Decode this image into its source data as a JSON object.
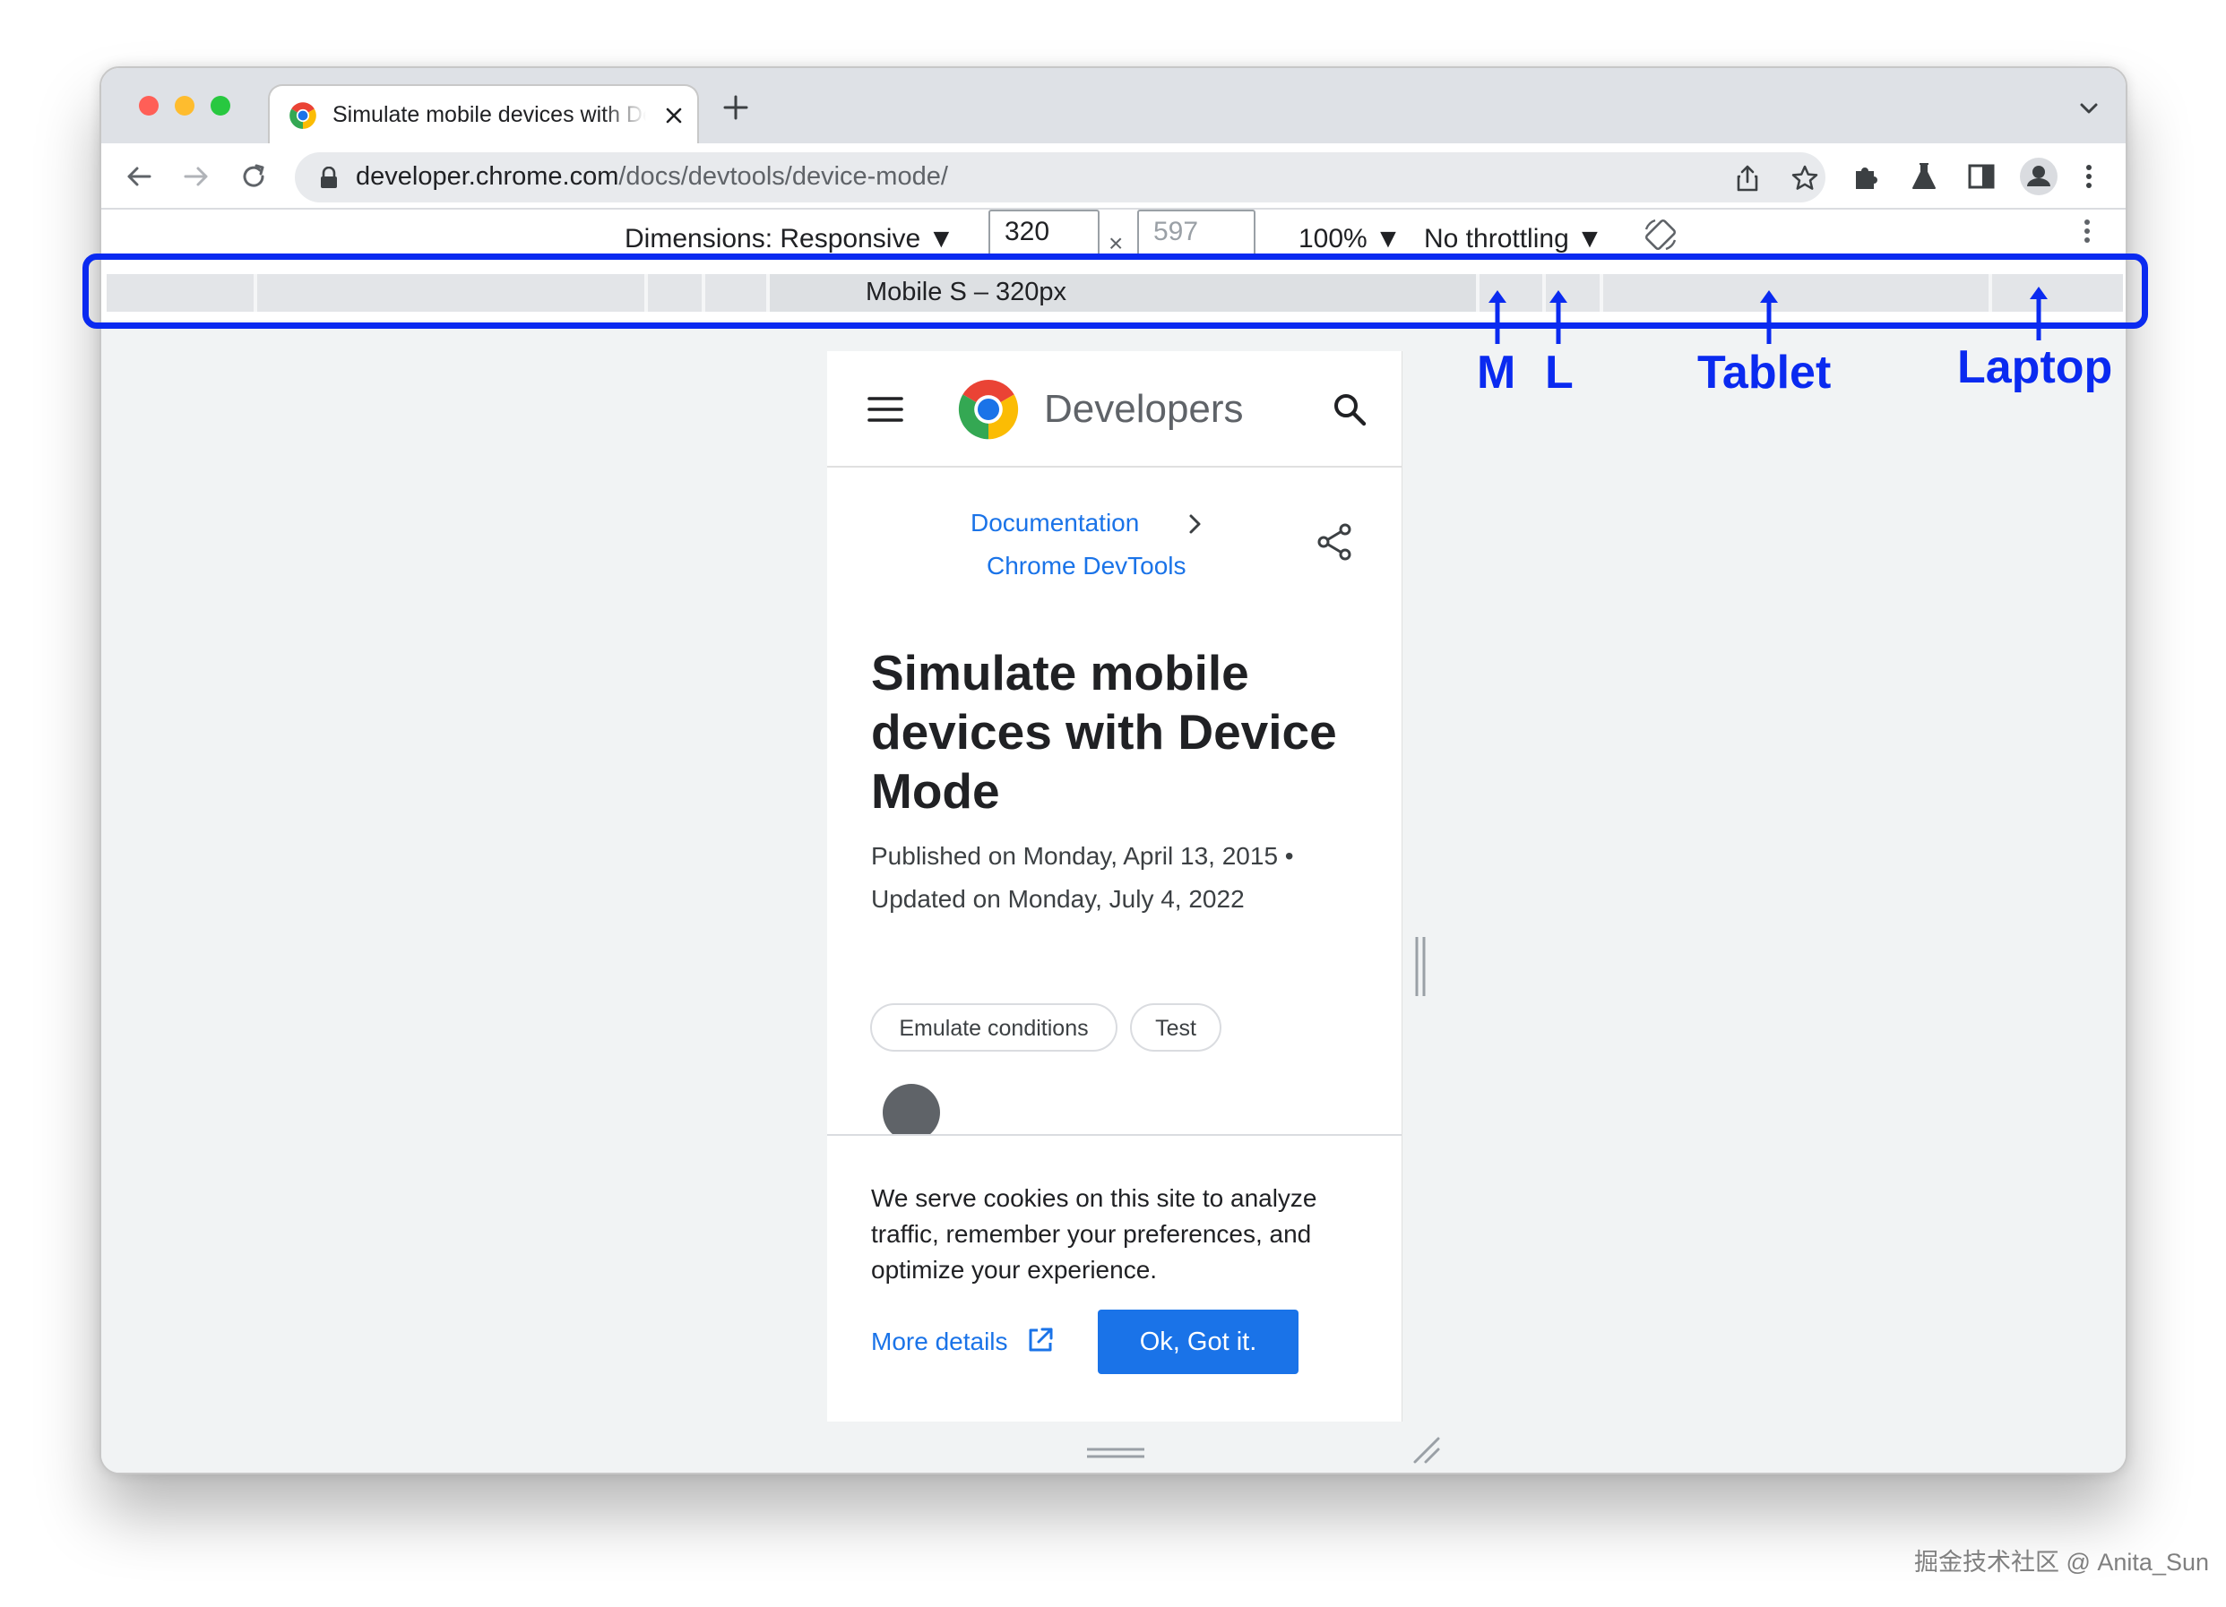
{
  "browser": {
    "tab": {
      "title": "Simulate mobile devices with Device Mode"
    },
    "url": {
      "host": "developer.chrome.com",
      "path": "/docs/devtools/device-mode/"
    }
  },
  "devtools": {
    "dimensions_label": "Dimensions: Responsive",
    "width_value": "320",
    "times": "×",
    "height_placeholder": "597",
    "zoom": "100%",
    "throttling": "No throttling",
    "media_query_label": "Mobile S – 320px"
  },
  "site": {
    "brand": "Developers",
    "breadcrumbs": [
      "Documentation",
      "Chrome DevTools"
    ],
    "title": "Simulate mobile devices with Device Mode",
    "published": "Published on Monday, April 13, 2015 •",
    "updated": "Updated on Monday, July 4, 2022",
    "tags": [
      "Emulate conditions",
      "Test"
    ],
    "cookie": {
      "text": "We serve cookies on this site to analyze traffic, remember your preferences, and optimize your experience.",
      "more_details": "More details",
      "ok": "Ok, Got it."
    }
  },
  "annotations": {
    "labels": [
      "M",
      "L",
      "Tablet",
      "Laptop"
    ],
    "color": "#0a2af0"
  },
  "colors": {
    "accent": "#1a73e8",
    "annotation": "#0a2af0"
  },
  "watermark": "掘金技术社区 @ Anita_Sun"
}
